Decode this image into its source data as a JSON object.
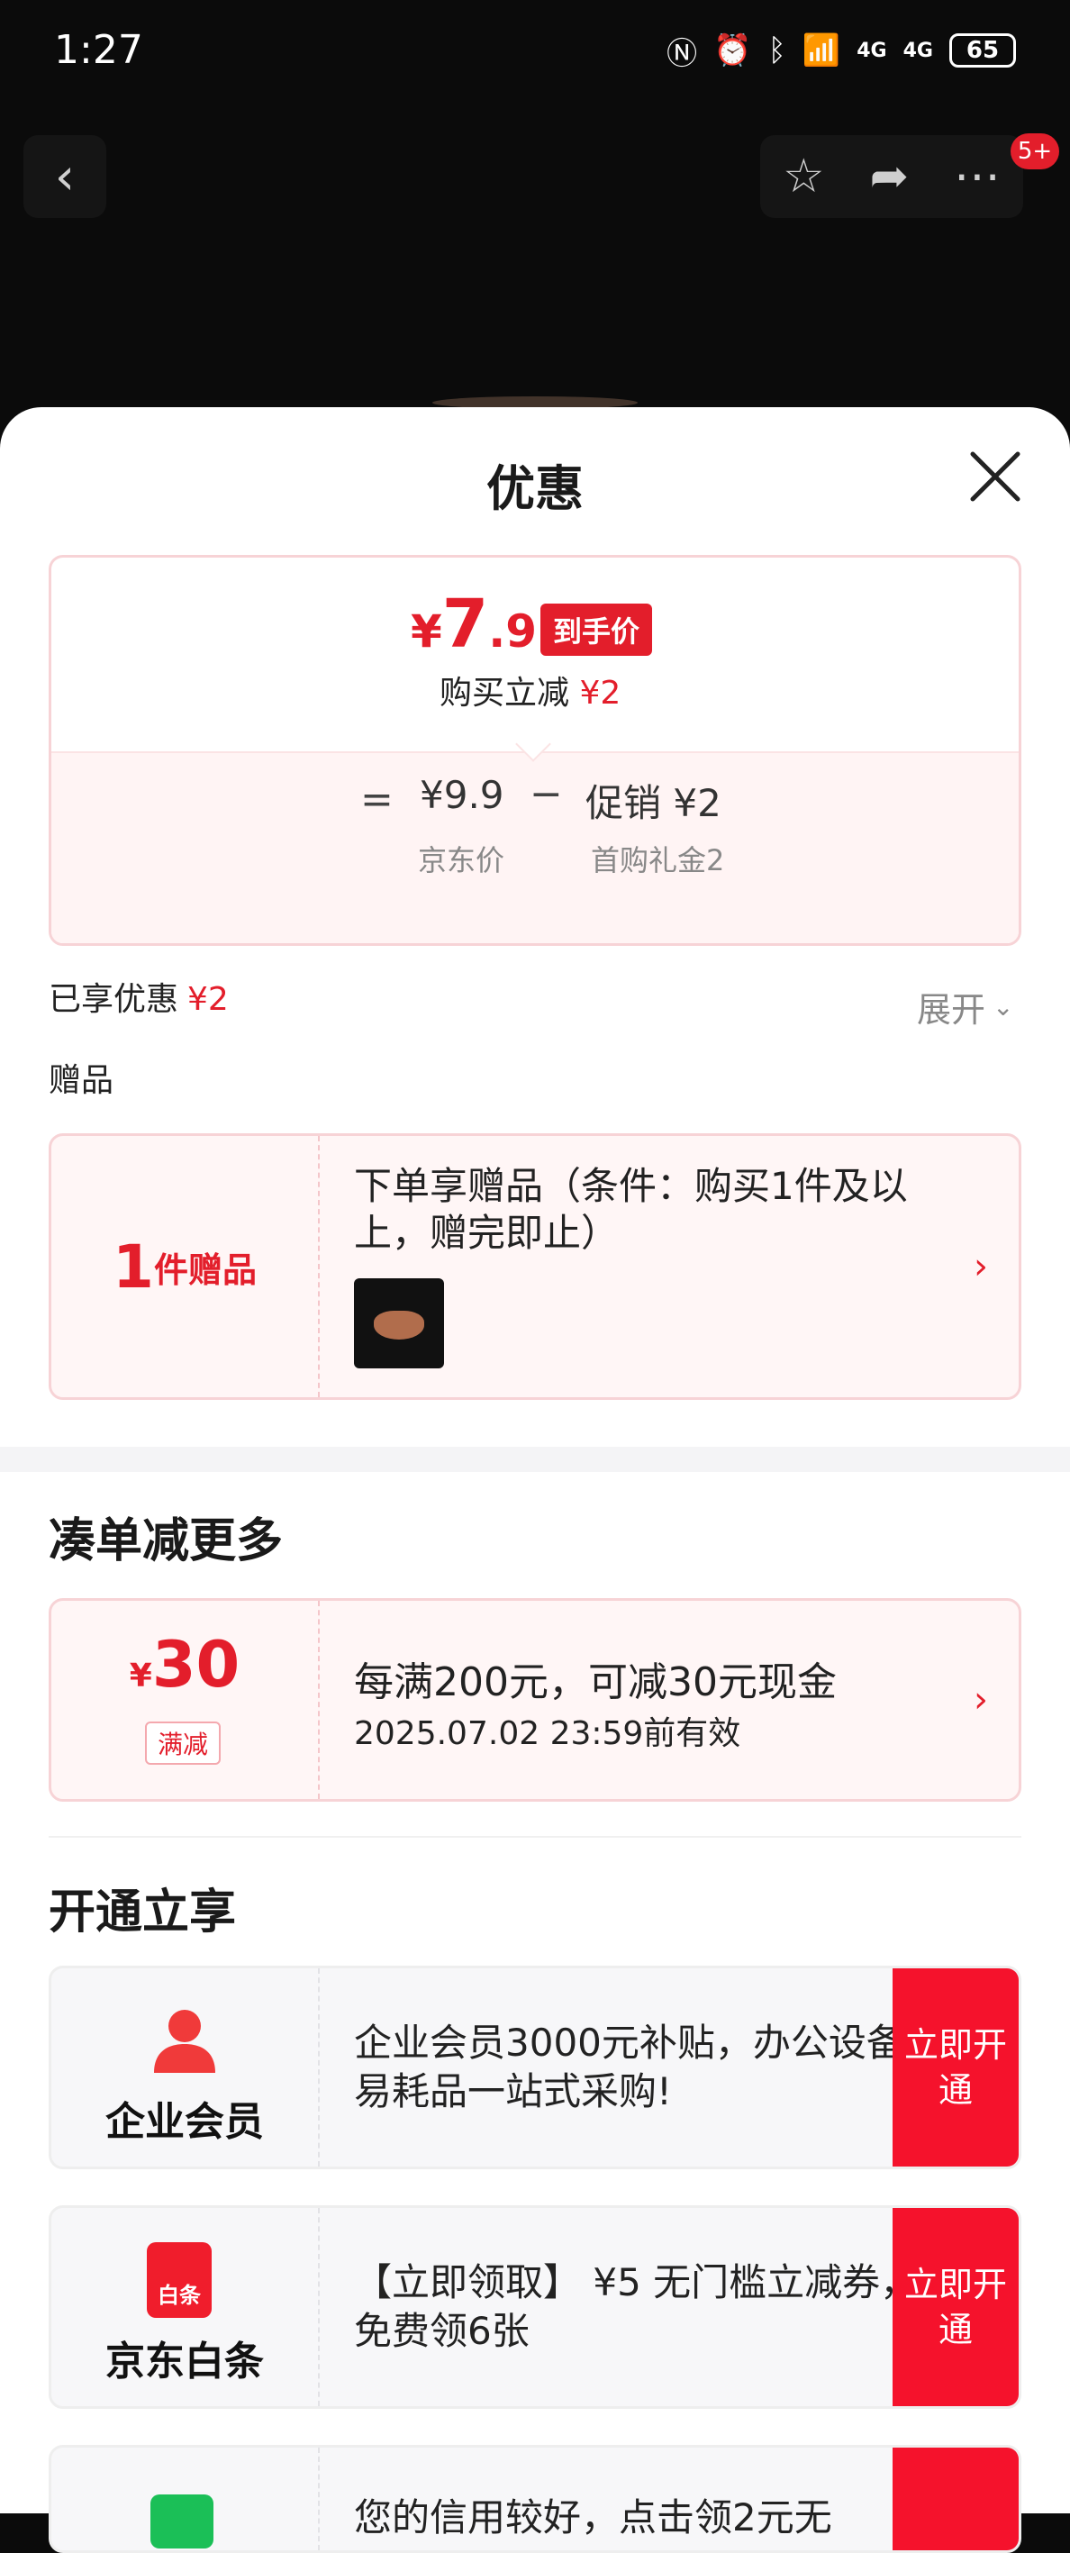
{
  "status_bar": {
    "time": "1:27",
    "battery": "65",
    "net1": "4G",
    "net2": "4G"
  },
  "nav": {
    "badge": "5+"
  },
  "sheet": {
    "title": "优惠"
  },
  "price_card": {
    "final_price_yen": "¥",
    "final_price_int": "7",
    "final_price_dec": ".9",
    "final_tag": "到手价",
    "discount_label": "购买立减",
    "discount_amount": "¥2",
    "equals": "=",
    "jd_price": "¥9.9",
    "jd_price_label": "京东价",
    "minus": "−",
    "promo": "促销 ¥2",
    "promo_note": "首购礼金2"
  },
  "enjoyed": {
    "label": "已享优惠",
    "amount": "¥2",
    "expand": "展开"
  },
  "gifts": {
    "label": "赠品",
    "count_num": "1",
    "count_unit": "件赠品",
    "text": "下单享赠品（条件：购买1件及以上，赠完即止）"
  },
  "more": {
    "title": "凑单减更多",
    "reduce_yen": "¥",
    "reduce_num": "30",
    "reduce_tag": "满减",
    "reduce_text": "每满200元，可减30元现金",
    "reduce_valid": "2025.07.02 23:59前有效"
  },
  "open": {
    "title": "开通立享",
    "cards": [
      {
        "name": "企业会员",
        "desc": " 企业会员3000元补贴，办公设备/易耗品一站式采购!",
        "cta": "立即开通"
      },
      {
        "name": "京东白条",
        "icon_text": "白条",
        "desc": "【立即领取】 ¥5 无门槛立减券，免费领6张",
        "cta": "立即开通"
      },
      {
        "desc": "您的信用较好，点击领2元无"
      }
    ]
  },
  "colors": {
    "accent": "#e31e2b",
    "cta": "#f5122c",
    "card_border": "#f7d3d6"
  }
}
